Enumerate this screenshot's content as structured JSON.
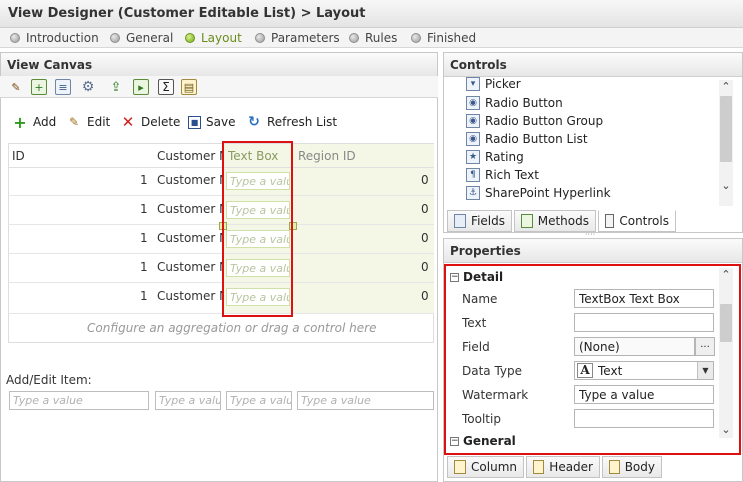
{
  "title": "View Designer (Customer Editable List) > Layout",
  "steps": [
    {
      "label": "Introduction",
      "active": false
    },
    {
      "label": "General",
      "active": false
    },
    {
      "label": "Layout",
      "active": true
    },
    {
      "label": "Parameters",
      "active": false
    },
    {
      "label": "Rules",
      "active": false
    },
    {
      "label": "Finished",
      "active": false
    }
  ],
  "canvas": {
    "header": "View Canvas",
    "toolbar_icons": [
      "wand-icon",
      "table-add-icon",
      "form-icon",
      "gear-icon",
      "export-icon",
      "import-icon",
      "sigma-icon",
      "properties-icon"
    ],
    "actions": {
      "add": "Add",
      "edit": "Edit",
      "delete": "Delete",
      "save": "Save",
      "refresh": "Refresh List"
    },
    "columns": [
      "ID",
      "Customer N",
      "Text Box",
      "Region ID"
    ],
    "rows": [
      {
        "id": "1",
        "customer": "Customer N",
        "textbox": "Type a valu",
        "region": "0"
      },
      {
        "id": "1",
        "customer": "Customer N",
        "textbox": "Type a valu",
        "region": "0"
      },
      {
        "id": "1",
        "customer": "Customer N",
        "textbox": "Type a valu",
        "region": "0"
      },
      {
        "id": "1",
        "customer": "Customer N",
        "textbox": "Type a valu",
        "region": "0"
      },
      {
        "id": "1",
        "customer": "Customer N",
        "textbox": "Type a valu",
        "region": "0"
      }
    ],
    "drop_hint": "Configure an aggregation or drag a control here",
    "add_edit_label": "Add/Edit Item:",
    "add_edit_inputs": [
      "Type a value",
      "Type a valu",
      "Type a valu",
      "Type a value"
    ]
  },
  "controls": {
    "header": "Controls",
    "items": [
      "Picker",
      "Radio Button",
      "Radio Button Group",
      "Radio Button List",
      "Rating",
      "Rich Text",
      "SharePoint Hyperlink"
    ],
    "tabs": [
      {
        "label": "Fields",
        "active": false
      },
      {
        "label": "Methods",
        "active": false
      },
      {
        "label": "Controls",
        "active": true
      }
    ]
  },
  "properties": {
    "header": "Properties",
    "detail_section": "Detail",
    "general_section": "General",
    "fields": {
      "name": {
        "label": "Name",
        "value": "TextBox Text Box"
      },
      "text": {
        "label": "Text",
        "value": ""
      },
      "field": {
        "label": "Field",
        "value": "(None)",
        "button": "..."
      },
      "data_type": {
        "label": "Data Type",
        "value": "Text",
        "icon": "A"
      },
      "watermark": {
        "label": "Watermark",
        "value": "Type a value"
      },
      "tooltip": {
        "label": "Tooltip",
        "value": ""
      }
    },
    "tabs": [
      "Column",
      "Header",
      "Body"
    ]
  },
  "colors": {
    "highlight_border": "#dd1111",
    "active_step": "#78a820",
    "column_highlight": "#f3f7e4"
  }
}
